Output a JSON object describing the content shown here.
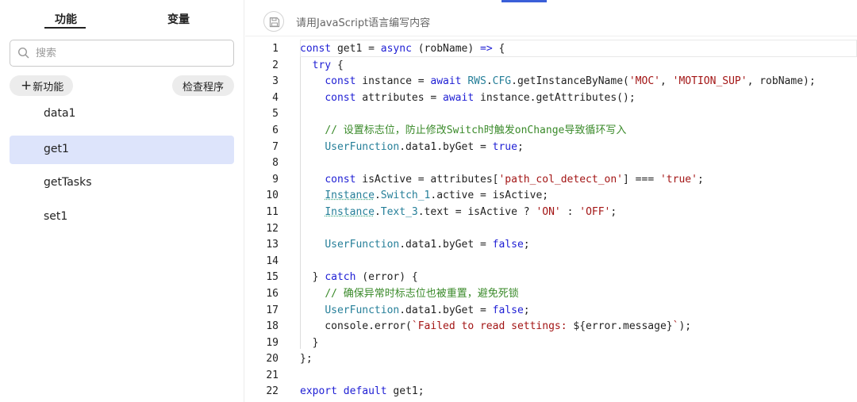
{
  "sidebar": {
    "tabs": {
      "functions": "功能",
      "variables": "变量"
    },
    "search_placeholder": "搜索",
    "new_function_label": "新功能",
    "new_function_plus": "+",
    "check_program_label": "检查程序",
    "functions": [
      "data1",
      "get1",
      "getTasks",
      "set1"
    ],
    "selected": "get1"
  },
  "editor": {
    "hint": "请用JavaScript语言编写内容",
    "line_numbers": [
      "1",
      "2",
      "3",
      "4",
      "5",
      "6",
      "7",
      "8",
      "9",
      "10",
      "11",
      "12",
      "13",
      "14",
      "15",
      "16",
      "17",
      "18",
      "19",
      "20",
      "21",
      "22"
    ]
  },
  "colors": {
    "accent": "#3a5fd8",
    "selected_bg": "#dde4fb",
    "keyword": "#1e1ed4",
    "string": "#a31515",
    "class": "#267f99",
    "comment": "#3a8a2a"
  }
}
